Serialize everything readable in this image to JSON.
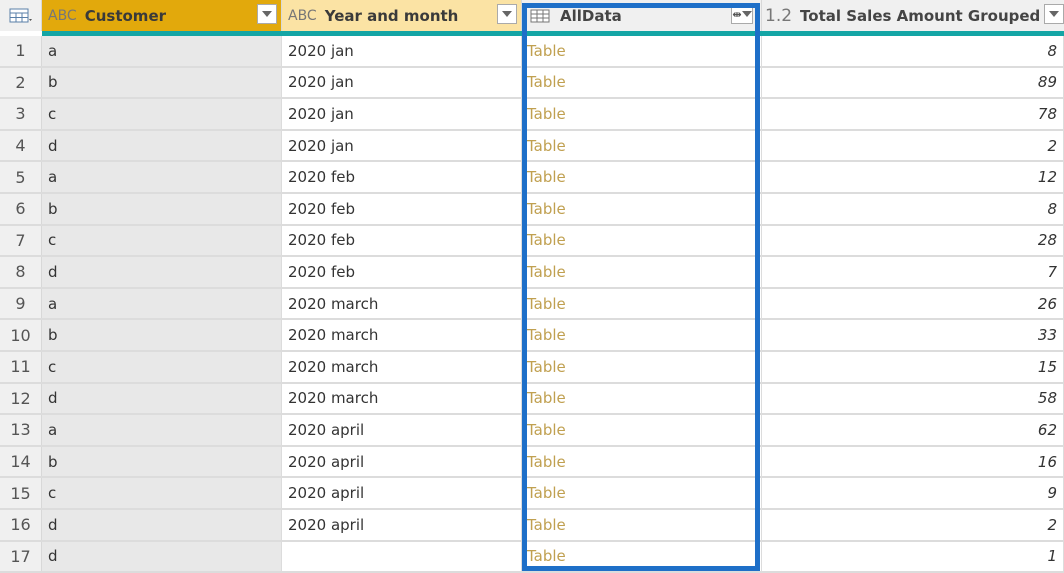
{
  "header": {
    "corner_icon": "table-icon",
    "columns": [
      {
        "name": "Customer",
        "type_icon": "ABC"
      },
      {
        "name": "Year and month",
        "type_icon": "ABC"
      },
      {
        "name": "AllData",
        "type_icon": "table-icon"
      },
      {
        "name": "Total Sales Amount Grouped",
        "type_icon": "1.2"
      }
    ]
  },
  "rows": [
    {
      "n": "1",
      "customer": "a",
      "ym": "2020 jan",
      "alldata": "Table",
      "total": "8"
    },
    {
      "n": "2",
      "customer": "b",
      "ym": "2020 jan",
      "alldata": "Table",
      "total": "89"
    },
    {
      "n": "3",
      "customer": "c",
      "ym": "2020 jan",
      "alldata": "Table",
      "total": "78"
    },
    {
      "n": "4",
      "customer": "d",
      "ym": "2020 jan",
      "alldata": "Table",
      "total": "2"
    },
    {
      "n": "5",
      "customer": "a",
      "ym": "2020 feb",
      "alldata": "Table",
      "total": "12"
    },
    {
      "n": "6",
      "customer": "b",
      "ym": "2020 feb",
      "alldata": "Table",
      "total": "8"
    },
    {
      "n": "7",
      "customer": "c",
      "ym": "2020 feb",
      "alldata": "Table",
      "total": "28"
    },
    {
      "n": "8",
      "customer": "d",
      "ym": "2020 feb",
      "alldata": "Table",
      "total": "7"
    },
    {
      "n": "9",
      "customer": "a",
      "ym": "2020 march",
      "alldata": "Table",
      "total": "26"
    },
    {
      "n": "10",
      "customer": "b",
      "ym": "2020 march",
      "alldata": "Table",
      "total": "33"
    },
    {
      "n": "11",
      "customer": "c",
      "ym": "2020 march",
      "alldata": "Table",
      "total": "15"
    },
    {
      "n": "12",
      "customer": "d",
      "ym": "2020 march",
      "alldata": "Table",
      "total": "58"
    },
    {
      "n": "13",
      "customer": "a",
      "ym": "2020 april",
      "alldata": "Table",
      "total": "62"
    },
    {
      "n": "14",
      "customer": "b",
      "ym": "2020 april",
      "alldata": "Table",
      "total": "16"
    },
    {
      "n": "15",
      "customer": "c",
      "ym": "2020 april",
      "alldata": "Table",
      "total": "9"
    },
    {
      "n": "16",
      "customer": "d",
      "ym": "2020 april",
      "alldata": "Table",
      "total": "2"
    },
    {
      "n": "17",
      "customer": "d",
      "ym": "",
      "alldata": "Table",
      "total": "1"
    }
  ]
}
